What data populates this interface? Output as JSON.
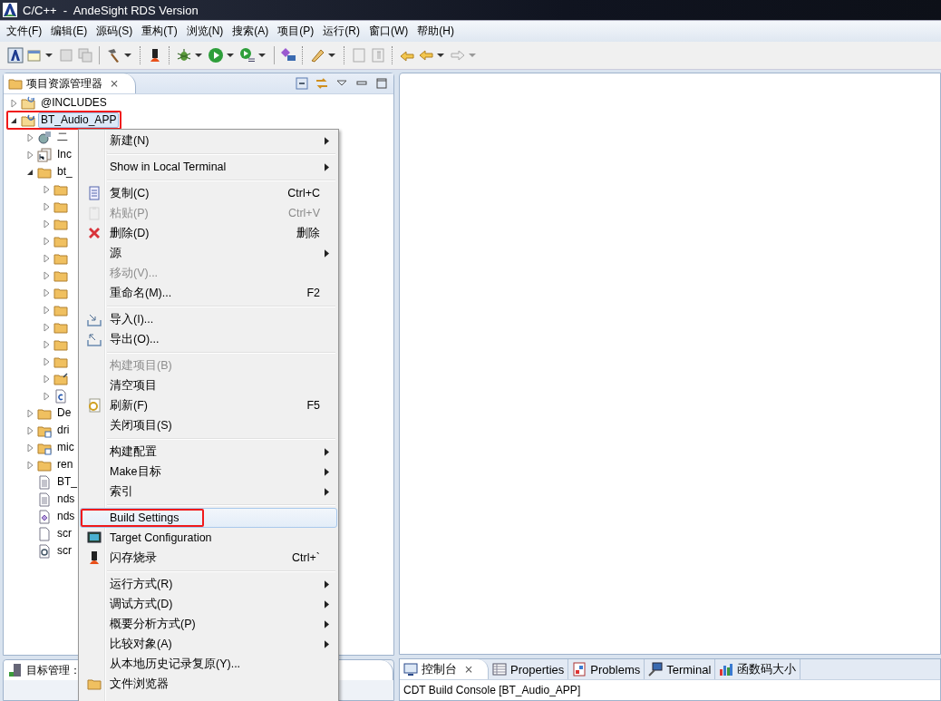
{
  "window": {
    "title": "C/C++  -  AndeSight RDS Version"
  },
  "menu_bar": [
    "文件(F)",
    "编辑(E)",
    "源码(S)",
    "重构(T)",
    "浏览(N)",
    "搜索(A)",
    "项目(P)",
    "运行(R)",
    "窗口(W)",
    "帮助(H)"
  ],
  "explorer": {
    "tab": {
      "label": "项目资源管理器",
      "close": "⨯"
    },
    "tree": [
      {
        "label": "@INCLUDES",
        "kind": "includes",
        "expanded": false,
        "selected": false
      },
      {
        "label": "BT_Audio_APP",
        "kind": "project",
        "expanded": true,
        "selected": true,
        "annotated": true,
        "children": [
          {
            "label": "二",
            "kind": "binaries",
            "expanded": false,
            "selected": false
          },
          {
            "label": "Inc",
            "kind": "headers",
            "expanded": false,
            "selected": false
          },
          {
            "label": "bt_",
            "kind": "folder",
            "expanded": true,
            "selected": false,
            "children": [
              {
                "kind": "folder",
                "expanded": false,
                "selected": false
              },
              {
                "kind": "folder",
                "expanded": false,
                "selected": false
              },
              {
                "kind": "folder",
                "expanded": false,
                "selected": false
              },
              {
                "kind": "folder",
                "expanded": false,
                "selected": false
              },
              {
                "kind": "folder",
                "expanded": false,
                "selected": false
              },
              {
                "kind": "folder",
                "expanded": false,
                "selected": false
              },
              {
                "kind": "folder",
                "expanded": false,
                "selected": false
              },
              {
                "kind": "folder",
                "expanded": false,
                "selected": false
              },
              {
                "kind": "folder",
                "expanded": false,
                "selected": false
              },
              {
                "kind": "folder",
                "expanded": false,
                "selected": false
              },
              {
                "kind": "folder",
                "expanded": false,
                "selected": false
              },
              {
                "kind": "folder-linked",
                "expanded": false,
                "selected": false
              },
              {
                "kind": "file-c",
                "expanded": false,
                "selected": false
              }
            ]
          },
          {
            "label": "De",
            "kind": "folder",
            "expanded": false,
            "selected": false
          },
          {
            "label": "dri",
            "kind": "source-folder",
            "expanded": false,
            "selected": false
          },
          {
            "label": "mic",
            "kind": "source-folder",
            "expanded": false,
            "selected": false
          },
          {
            "label": "ren",
            "kind": "folder",
            "expanded": false,
            "selected": false
          },
          {
            "label": "BT_",
            "kind": "file-text",
            "selected": false
          },
          {
            "label": "nds",
            "kind": "file-text",
            "selected": false
          },
          {
            "label": "nds",
            "kind": "file-linker",
            "selected": false
          },
          {
            "label": "scr",
            "kind": "file-blank",
            "selected": false
          },
          {
            "label": "scr",
            "kind": "file-settings",
            "selected": false
          }
        ]
      }
    ]
  },
  "context_menu": [
    {
      "kind": "item",
      "label": "新建(N)",
      "submenu": true,
      "disabled": false,
      "selected": false
    },
    {
      "kind": "separator"
    },
    {
      "kind": "item",
      "label": "Show in Local Terminal",
      "submenu": true,
      "disabled": false,
      "selected": false
    },
    {
      "kind": "separator"
    },
    {
      "kind": "item",
      "label": "复制(C)",
      "shortcut": "Ctrl+C",
      "disabled": false,
      "selected": false
    },
    {
      "kind": "item",
      "label": "粘贴(P)",
      "shortcut": "Ctrl+V",
      "disabled": true,
      "selected": false
    },
    {
      "kind": "item",
      "label": "删除(D)",
      "shortcut": "删除",
      "disabled": false,
      "selected": false
    },
    {
      "kind": "item",
      "label": "源",
      "submenu": true,
      "disabled": false,
      "selected": false
    },
    {
      "kind": "item",
      "label": "移动(V)...",
      "disabled": true,
      "selected": false
    },
    {
      "kind": "item",
      "label": "重命名(M)...",
      "shortcut": "F2",
      "disabled": false,
      "selected": false
    },
    {
      "kind": "separator"
    },
    {
      "kind": "item",
      "label": "导入(I)...",
      "disabled": false,
      "selected": false
    },
    {
      "kind": "item",
      "label": "导出(O)...",
      "disabled": false,
      "selected": false
    },
    {
      "kind": "separator"
    },
    {
      "kind": "item",
      "label": "构建项目(B)",
      "disabled": true,
      "selected": false
    },
    {
      "kind": "item",
      "label": "清空项目",
      "disabled": false,
      "selected": false
    },
    {
      "kind": "item",
      "label": "刷新(F)",
      "shortcut": "F5",
      "disabled": false,
      "selected": false
    },
    {
      "kind": "item",
      "label": "关闭项目(S)",
      "disabled": false,
      "selected": false
    },
    {
      "kind": "separator"
    },
    {
      "kind": "item",
      "label": "构建配置",
      "submenu": true,
      "disabled": false,
      "selected": false
    },
    {
      "kind": "item",
      "label": "Make目标",
      "submenu": true,
      "disabled": false,
      "selected": false
    },
    {
      "kind": "item",
      "label": "索引",
      "submenu": true,
      "disabled": false,
      "selected": false
    },
    {
      "kind": "separator"
    },
    {
      "kind": "item",
      "label": "Build Settings",
      "disabled": false,
      "selected": true,
      "annotated": true
    },
    {
      "kind": "item",
      "label": "Target Configuration",
      "disabled": false,
      "selected": false
    },
    {
      "kind": "item",
      "label": "闪存烧录",
      "shortcut": "Ctrl+`",
      "disabled": false,
      "selected": false
    },
    {
      "kind": "separator"
    },
    {
      "kind": "item",
      "label": "运行方式(R)",
      "submenu": true,
      "disabled": false,
      "selected": false
    },
    {
      "kind": "item",
      "label": "调试方式(D)",
      "submenu": true,
      "disabled": false,
      "selected": false
    },
    {
      "kind": "item",
      "label": "概要分析方式(P)",
      "submenu": true,
      "disabled": false,
      "selected": false
    },
    {
      "kind": "item",
      "label": "比较对象(A)",
      "submenu": true,
      "disabled": false,
      "selected": false
    },
    {
      "kind": "item",
      "label": "从本地历史记录复原(Y)...",
      "disabled": false,
      "selected": false
    },
    {
      "kind": "item",
      "label": "文件浏览器",
      "disabled": false,
      "selected": false
    }
  ],
  "target_panel": {
    "tab": "目标管理："
  },
  "console": {
    "tabs": [
      {
        "label": "控制台",
        "close": "⨯",
        "selected": true
      },
      {
        "label": "Properties",
        "selected": false
      },
      {
        "label": "Problems",
        "selected": false
      },
      {
        "label": "Terminal",
        "selected": false
      },
      {
        "label": "函数码大小",
        "selected": false
      }
    ],
    "text": "CDT Build Console [BT_Audio_APP]"
  }
}
